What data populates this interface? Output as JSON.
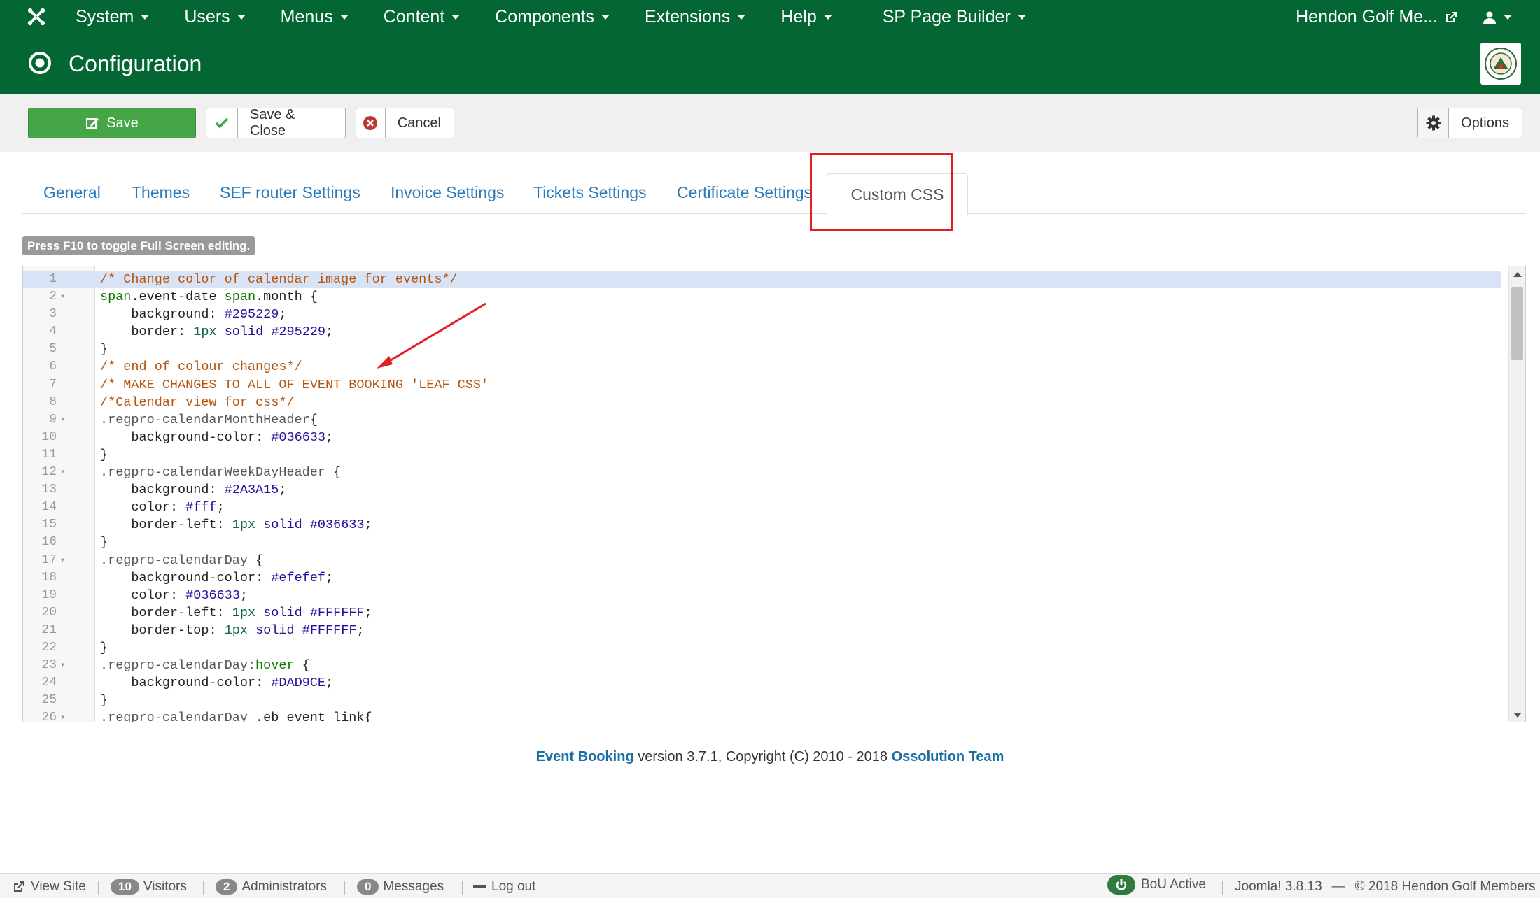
{
  "navbar": {
    "menu": [
      {
        "label": "System"
      },
      {
        "label": "Users"
      },
      {
        "label": "Menus"
      },
      {
        "label": "Content"
      },
      {
        "label": "Components"
      },
      {
        "label": "Extensions"
      },
      {
        "label": "Help"
      },
      {
        "label": "SP Page Builder"
      }
    ],
    "site_name": "Hendon Golf Me...",
    "icons": {
      "logo": "joomla-logo",
      "external": "external-link-icon",
      "user": "user-icon"
    }
  },
  "header": {
    "title": "Configuration"
  },
  "toolbar": {
    "save_label": "Save",
    "save_close_label": "Save & Close",
    "cancel_label": "Cancel",
    "options_label": "Options"
  },
  "tabs": {
    "general": "General",
    "themes": "Themes",
    "sef": "SEF router Settings",
    "invoice": "Invoice Settings",
    "tickets": "Tickets Settings",
    "certificate": "Certificate Settings",
    "custom_css": "Custom CSS",
    "active": "Custom CSS"
  },
  "editor": {
    "hint": "Press F10 to toggle Full Screen editing.",
    "lines": [
      "/* Change color of calendar image for events*/",
      "span.event-date span.month {",
      "    background: #295229;",
      "    border: 1px solid #295229;",
      "}",
      "/* end of colour changes*/",
      "/* MAKE CHANGES TO ALL OF EVENT BOOKING 'LEAF CSS'",
      "/*Calendar view for css*/",
      ".regpro-calendarMonthHeader{",
      "    background-color: #036633;",
      "}",
      ".regpro-calendarWeekDayHeader {",
      "    background: #2A3A15;",
      "    color: #fff;",
      "    border-left: 1px solid #036633;",
      "}",
      ".regpro-calendarDay {",
      "    background-color: #efefef;",
      "    color: #036633;",
      "    border-left: 1px solid #FFFFFF;",
      "    border-top: 1px solid #FFFFFF;",
      "}",
      ".regpro-calendarDay:hover {",
      "    background-color: #DAD9CE;",
      "}",
      ".regpro-calendarDay .eb_event_link{"
    ],
    "foldable_lines": [
      2,
      9,
      12,
      17,
      23,
      26
    ]
  },
  "footer": {
    "product": "Event Booking",
    "version_text": " version 3.7.1, Copyright (C) 2010 - 2018 ",
    "team": "Ossolution Team"
  },
  "statusbar": {
    "view_site": "View Site",
    "visitors_count": "10",
    "visitors_label": "Visitors",
    "admins_count": "2",
    "admins_label": "Administrators",
    "messages_count": "0",
    "messages_label": "Messages",
    "logout": "Log out",
    "bou": "BoU Active",
    "version": "Joomla! 3.8.13",
    "dash": "—",
    "copyright": "© 2018 Hendon Golf Members"
  },
  "colors": {
    "brand_green": "#036633",
    "save_green": "#46a546",
    "link_blue": "#2a7ab8",
    "highlight_red": "#e41e26"
  }
}
